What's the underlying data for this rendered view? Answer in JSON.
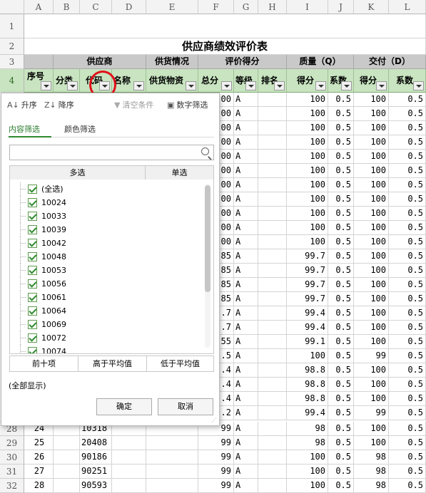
{
  "columns": [
    "A",
    "B",
    "C",
    "D",
    "E",
    "F",
    "G",
    "H",
    "I",
    "J",
    "K",
    "L"
  ],
  "title": "供应商绩效评价表",
  "group_headers": {
    "supplier": "供应商",
    "supply": "供货情况",
    "eval": "评价得分",
    "quality": "质量（Q）",
    "delivery": "交付（D）"
  },
  "field_headers": {
    "seq": "序号",
    "category": "分类",
    "code": "代码",
    "name": "名称",
    "material": "供货物资",
    "total": "总分",
    "grade": "等级",
    "rank": "排名",
    "q_score": "得分",
    "q_coef": "系数",
    "d_score": "得分",
    "d_coef": "系数"
  },
  "row_numbers": [
    "1",
    "2",
    "3",
    "4",
    "28",
    "29",
    "30",
    "31",
    "32"
  ],
  "data_rows": [
    {
      "f": "00",
      "g": "A",
      "i": "100",
      "j": "0.5",
      "k": "100",
      "l": "0.5"
    },
    {
      "f": "00",
      "g": "A",
      "i": "100",
      "j": "0.5",
      "k": "100",
      "l": "0.5"
    },
    {
      "f": "00",
      "g": "A",
      "i": "100",
      "j": "0.5",
      "k": "100",
      "l": "0.5"
    },
    {
      "f": "00",
      "g": "A",
      "i": "100",
      "j": "0.5",
      "k": "100",
      "l": "0.5"
    },
    {
      "f": "00",
      "g": "A",
      "i": "100",
      "j": "0.5",
      "k": "100",
      "l": "0.5"
    },
    {
      "f": "00",
      "g": "A",
      "i": "100",
      "j": "0.5",
      "k": "100",
      "l": "0.5"
    },
    {
      "f": "00",
      "g": "A",
      "i": "100",
      "j": "0.5",
      "k": "100",
      "l": "0.5"
    },
    {
      "f": "00",
      "g": "A",
      "i": "100",
      "j": "0.5",
      "k": "100",
      "l": "0.5"
    },
    {
      "f": "00",
      "g": "A",
      "i": "100",
      "j": "0.5",
      "k": "100",
      "l": "0.5"
    },
    {
      "f": "00",
      "g": "A",
      "i": "100",
      "j": "0.5",
      "k": "100",
      "l": "0.5"
    },
    {
      "f": "00",
      "g": "A",
      "i": "100",
      "j": "0.5",
      "k": "100",
      "l": "0.5"
    },
    {
      "f": "85",
      "g": "A",
      "i": "99.7",
      "j": "0.5",
      "k": "100",
      "l": "0.5"
    },
    {
      "f": "85",
      "g": "A",
      "i": "99.7",
      "j": "0.5",
      "k": "100",
      "l": "0.5"
    },
    {
      "f": "85",
      "g": "A",
      "i": "99.7",
      "j": "0.5",
      "k": "100",
      "l": "0.5"
    },
    {
      "f": "85",
      "g": "A",
      "i": "99.7",
      "j": "0.5",
      "k": "100",
      "l": "0.5"
    },
    {
      "f": ".7",
      "g": "A",
      "i": "99.4",
      "j": "0.5",
      "k": "100",
      "l": "0.5"
    },
    {
      "f": ".7",
      "g": "A",
      "i": "99.4",
      "j": "0.5",
      "k": "100",
      "l": "0.5"
    },
    {
      "f": "55",
      "g": "A",
      "i": "99.1",
      "j": "0.5",
      "k": "100",
      "l": "0.5"
    },
    {
      "f": ".5",
      "g": "A",
      "i": "100",
      "j": "0.5",
      "k": "99",
      "l": "0.5"
    },
    {
      "f": ".4",
      "g": "A",
      "i": "98.8",
      "j": "0.5",
      "k": "100",
      "l": "0.5"
    },
    {
      "f": ".4",
      "g": "A",
      "i": "98.8",
      "j": "0.5",
      "k": "100",
      "l": "0.5"
    },
    {
      "f": ".4",
      "g": "A",
      "i": "98.8",
      "j": "0.5",
      "k": "100",
      "l": "0.5"
    },
    {
      "f": ".2",
      "g": "A",
      "i": "99.4",
      "j": "0.5",
      "k": "99",
      "l": "0.5"
    }
  ],
  "bottom_rows": [
    {
      "row": "28",
      "a": "24",
      "c": "10318",
      "f": "99",
      "g": "A",
      "i": "98",
      "j": "0.5",
      "k": "100",
      "l": "0.5"
    },
    {
      "row": "29",
      "a": "25",
      "c": "20408",
      "f": "99",
      "g": "A",
      "i": "98",
      "j": "0.5",
      "k": "100",
      "l": "0.5"
    },
    {
      "row": "30",
      "a": "26",
      "c": "90186",
      "f": "99",
      "g": "A",
      "i": "100",
      "j": "0.5",
      "k": "98",
      "l": "0.5"
    },
    {
      "row": "31",
      "a": "27",
      "c": "90251",
      "f": "99",
      "g": "A",
      "i": "100",
      "j": "0.5",
      "k": "98",
      "l": "0.5"
    },
    {
      "row": "32",
      "a": "28",
      "c": "90593",
      "f": "99",
      "g": "A",
      "i": "100",
      "j": "0.5",
      "k": "98",
      "l": "0.5"
    }
  ],
  "filter_panel": {
    "sort_asc": "升序",
    "sort_desc": "降序",
    "clear": "清空条件",
    "number_filter": "数字筛选",
    "tab_content": "内容筛选",
    "tab_color": "颜色筛选",
    "search_placeholder": "",
    "multi": "多选",
    "single": "单选",
    "items": [
      "(全选)",
      "10024",
      "10033",
      "10039",
      "10042",
      "10048",
      "10053",
      "10056",
      "10061",
      "10064",
      "10069",
      "10072",
      "10074"
    ],
    "top10": "前十项",
    "above_avg": "高于平均值",
    "below_avg": "低于平均值",
    "show_all": "(全部显示)",
    "ok": "确定",
    "cancel": "取消"
  },
  "colors": {
    "accent_green": "#2e8b2e",
    "header_gray": "#c9c9c9",
    "header_green": "#c8e4c0",
    "highlight_red": "#e0101a"
  }
}
